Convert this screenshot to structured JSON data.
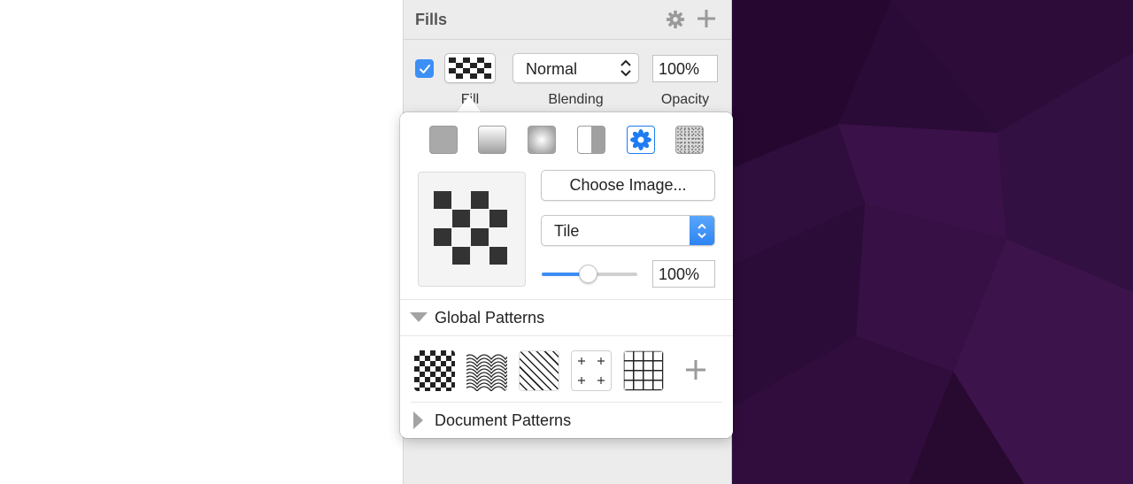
{
  "panel": {
    "title": "Fills",
    "header_icons": [
      "gear-icon",
      "plus-icon"
    ]
  },
  "fill_row": {
    "enabled": true,
    "blending_value": "Normal",
    "opacity_value": "100%",
    "labels": {
      "fill": "Fill",
      "blending": "Blending",
      "opacity": "Opacity"
    }
  },
  "popover": {
    "fill_types": [
      "solid-color",
      "linear-gradient",
      "radial-gradient",
      "angular-gradient",
      "pattern-fill",
      "noise-fill"
    ],
    "selected_fill_type": "pattern-fill",
    "choose_image_label": "Choose Image...",
    "tile_mode_value": "Tile",
    "scale_value": "100%",
    "scale_slider_fraction": 0.49,
    "global_patterns_label": "Global Patterns",
    "global_patterns": [
      "checker-pattern",
      "waves-pattern",
      "diagonal-stripes-pattern",
      "plus-pattern",
      "grid-pattern"
    ],
    "document_patterns_label": "Document Patterns"
  },
  "colors": {
    "accent": "#3b8ff5",
    "canvas_dark": "#2a0a36",
    "panel_bg": "#ececec"
  }
}
